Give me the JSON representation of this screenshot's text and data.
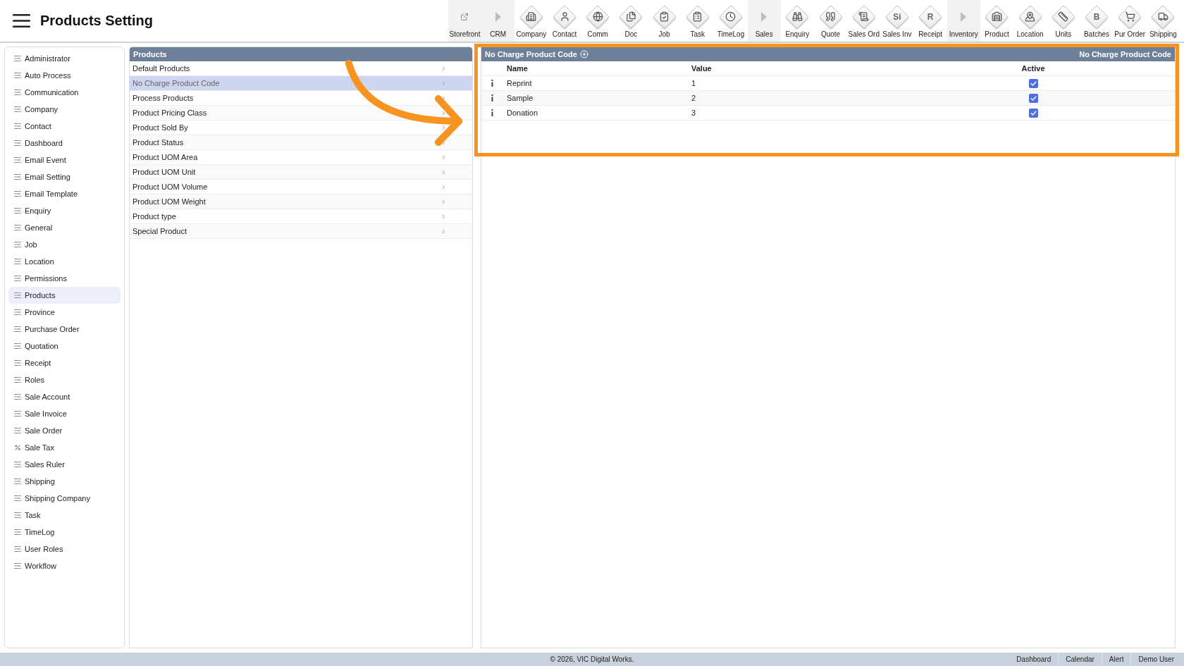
{
  "header": {
    "title": "Products Setting"
  },
  "toolbar": [
    {
      "label": "Storefront",
      "kind": "link"
    },
    {
      "label": "CRM",
      "kind": "group"
    },
    {
      "label": "Company",
      "kind": "module"
    },
    {
      "label": "Contact",
      "kind": "module"
    },
    {
      "label": "Comm",
      "kind": "module"
    },
    {
      "label": "Doc",
      "kind": "module"
    },
    {
      "label": "Job",
      "kind": "module"
    },
    {
      "label": "Task",
      "kind": "module"
    },
    {
      "label": "TimeLog",
      "kind": "module"
    },
    {
      "label": "Sales",
      "kind": "group"
    },
    {
      "label": "Enquiry",
      "kind": "module"
    },
    {
      "label": "Quote",
      "kind": "module"
    },
    {
      "label": "Sales Ord",
      "kind": "module"
    },
    {
      "label": "Sales Inv",
      "kind": "letter",
      "glyph": "Si"
    },
    {
      "label": "Receipt",
      "kind": "letter",
      "glyph": "R"
    },
    {
      "label": "Inventory",
      "kind": "group"
    },
    {
      "label": "Product",
      "kind": "module"
    },
    {
      "label": "Location",
      "kind": "module"
    },
    {
      "label": "Units",
      "kind": "module"
    },
    {
      "label": "Batches",
      "kind": "letter",
      "glyph": "B"
    },
    {
      "label": "Pur Order",
      "kind": "module"
    },
    {
      "label": "Shipping",
      "kind": "module"
    }
  ],
  "sidebar": {
    "items": [
      {
        "label": "Administrator",
        "kind": "settings",
        "selected": false
      },
      {
        "label": "Auto Process",
        "kind": "settings",
        "selected": false
      },
      {
        "label": "Communication",
        "kind": "settings",
        "selected": false
      },
      {
        "label": "Company",
        "kind": "settings",
        "selected": false
      },
      {
        "label": "Contact",
        "kind": "settings",
        "selected": false
      },
      {
        "label": "Dashboard",
        "kind": "settings",
        "selected": false
      },
      {
        "label": "Email Event",
        "kind": "settings",
        "selected": false
      },
      {
        "label": "Email Setting",
        "kind": "settings",
        "selected": false
      },
      {
        "label": "Email Template",
        "kind": "settings",
        "selected": false
      },
      {
        "label": "Enquiry",
        "kind": "settings",
        "selected": false
      },
      {
        "label": "General",
        "kind": "settings",
        "selected": false
      },
      {
        "label": "Job",
        "kind": "settings",
        "selected": false
      },
      {
        "label": "Location",
        "kind": "settings",
        "selected": false
      },
      {
        "label": "Permissions",
        "kind": "settings",
        "selected": false
      },
      {
        "label": "Products",
        "kind": "settings",
        "selected": true
      },
      {
        "label": "Province",
        "kind": "settings",
        "selected": false
      },
      {
        "label": "Purchase Order",
        "kind": "settings",
        "selected": false
      },
      {
        "label": "Quotation",
        "kind": "settings",
        "selected": false
      },
      {
        "label": "Receipt",
        "kind": "settings",
        "selected": false
      },
      {
        "label": "Roles",
        "kind": "settings",
        "selected": false
      },
      {
        "label": "Sale Account",
        "kind": "settings",
        "selected": false
      },
      {
        "label": "Sale Invoice",
        "kind": "settings",
        "selected": false
      },
      {
        "label": "Sale Order",
        "kind": "settings",
        "selected": false
      },
      {
        "label": "Sale Tax",
        "kind": "percent",
        "selected": false
      },
      {
        "label": "Sales Ruler",
        "kind": "settings",
        "selected": false
      },
      {
        "label": "Shipping",
        "kind": "settings",
        "selected": false
      },
      {
        "label": "Shipping Company",
        "kind": "settings",
        "selected": false
      },
      {
        "label": "Task",
        "kind": "settings",
        "selected": false
      },
      {
        "label": "TimeLog",
        "kind": "settings",
        "selected": false
      },
      {
        "label": "User Roles",
        "kind": "settings",
        "selected": false
      },
      {
        "label": "Workflow",
        "kind": "settings",
        "selected": false
      }
    ]
  },
  "category_list": {
    "title": "Products",
    "items": [
      {
        "label": "Default Products",
        "selected": false
      },
      {
        "label": "No Charge Product Code",
        "selected": true
      },
      {
        "label": "Process Products",
        "selected": false
      },
      {
        "label": "Product Pricing Class",
        "selected": false
      },
      {
        "label": "Product Sold By",
        "selected": false
      },
      {
        "label": "Product Status",
        "selected": false
      },
      {
        "label": "Product UOM Area",
        "selected": false
      },
      {
        "label": "Product UOM Unit",
        "selected": false
      },
      {
        "label": "Product UOM Volume",
        "selected": false
      },
      {
        "label": "Product UOM Weight",
        "selected": false
      },
      {
        "label": "Product type",
        "selected": false
      },
      {
        "label": "Special Product",
        "selected": false
      }
    ]
  },
  "detail": {
    "title": "No Charge Product Code",
    "title_right": "No Charge Product Code",
    "columns": [
      "Name",
      "Value",
      "Active"
    ],
    "rows": [
      {
        "name": "Reprint",
        "value": "1",
        "active": true
      },
      {
        "name": "Sample",
        "value": "2",
        "active": true
      },
      {
        "name": "Donation",
        "value": "3",
        "active": true
      }
    ]
  },
  "footer": {
    "copyright": "© 2026, VIC Digital Works.",
    "links": [
      "Dashboard",
      "Calendar",
      "Alert",
      "Demo User"
    ]
  }
}
